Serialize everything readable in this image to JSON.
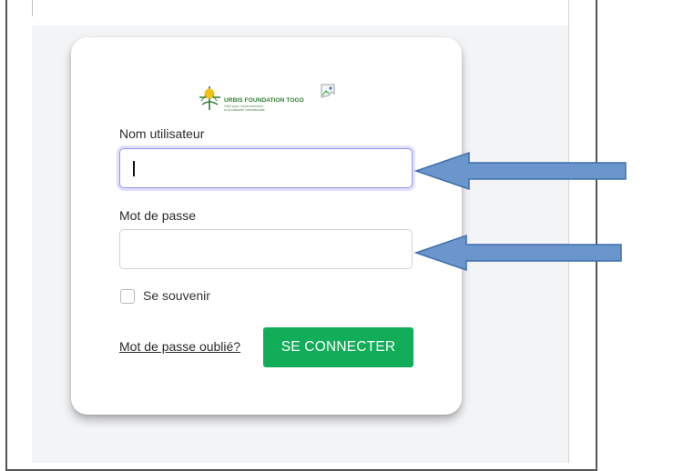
{
  "window": {
    "frame_color": "#555555",
    "page_background": "#f3f4f6"
  },
  "logo": {
    "title": "URBIS FOUNDATION TOGO",
    "subtitle_line1": "ONG pour l'environnement",
    "subtitle_line2": "et la solidarité internationale",
    "mark_icon": "urbis-foundation-logo-mark",
    "broken_image_icon": "broken-image-icon"
  },
  "login_form": {
    "username_label": "Nom utilisateur",
    "username_value": "",
    "password_label": "Mot de passe",
    "password_value": "",
    "remember_label": "Se souvenir",
    "remember_checked": false,
    "forgot_link": "Mot de passe oublié?",
    "submit_label": "SE CONNECTER"
  },
  "colors": {
    "submit_button": "#12ad58",
    "focus_border": "#8f93f0",
    "annotation_arrow_fill": "#6b96cc",
    "annotation_arrow_stroke": "#3f6fae"
  },
  "annotations": [
    {
      "points_to": "username-input",
      "icon": "left-arrow-icon"
    },
    {
      "points_to": "password-input",
      "icon": "left-arrow-icon"
    }
  ]
}
